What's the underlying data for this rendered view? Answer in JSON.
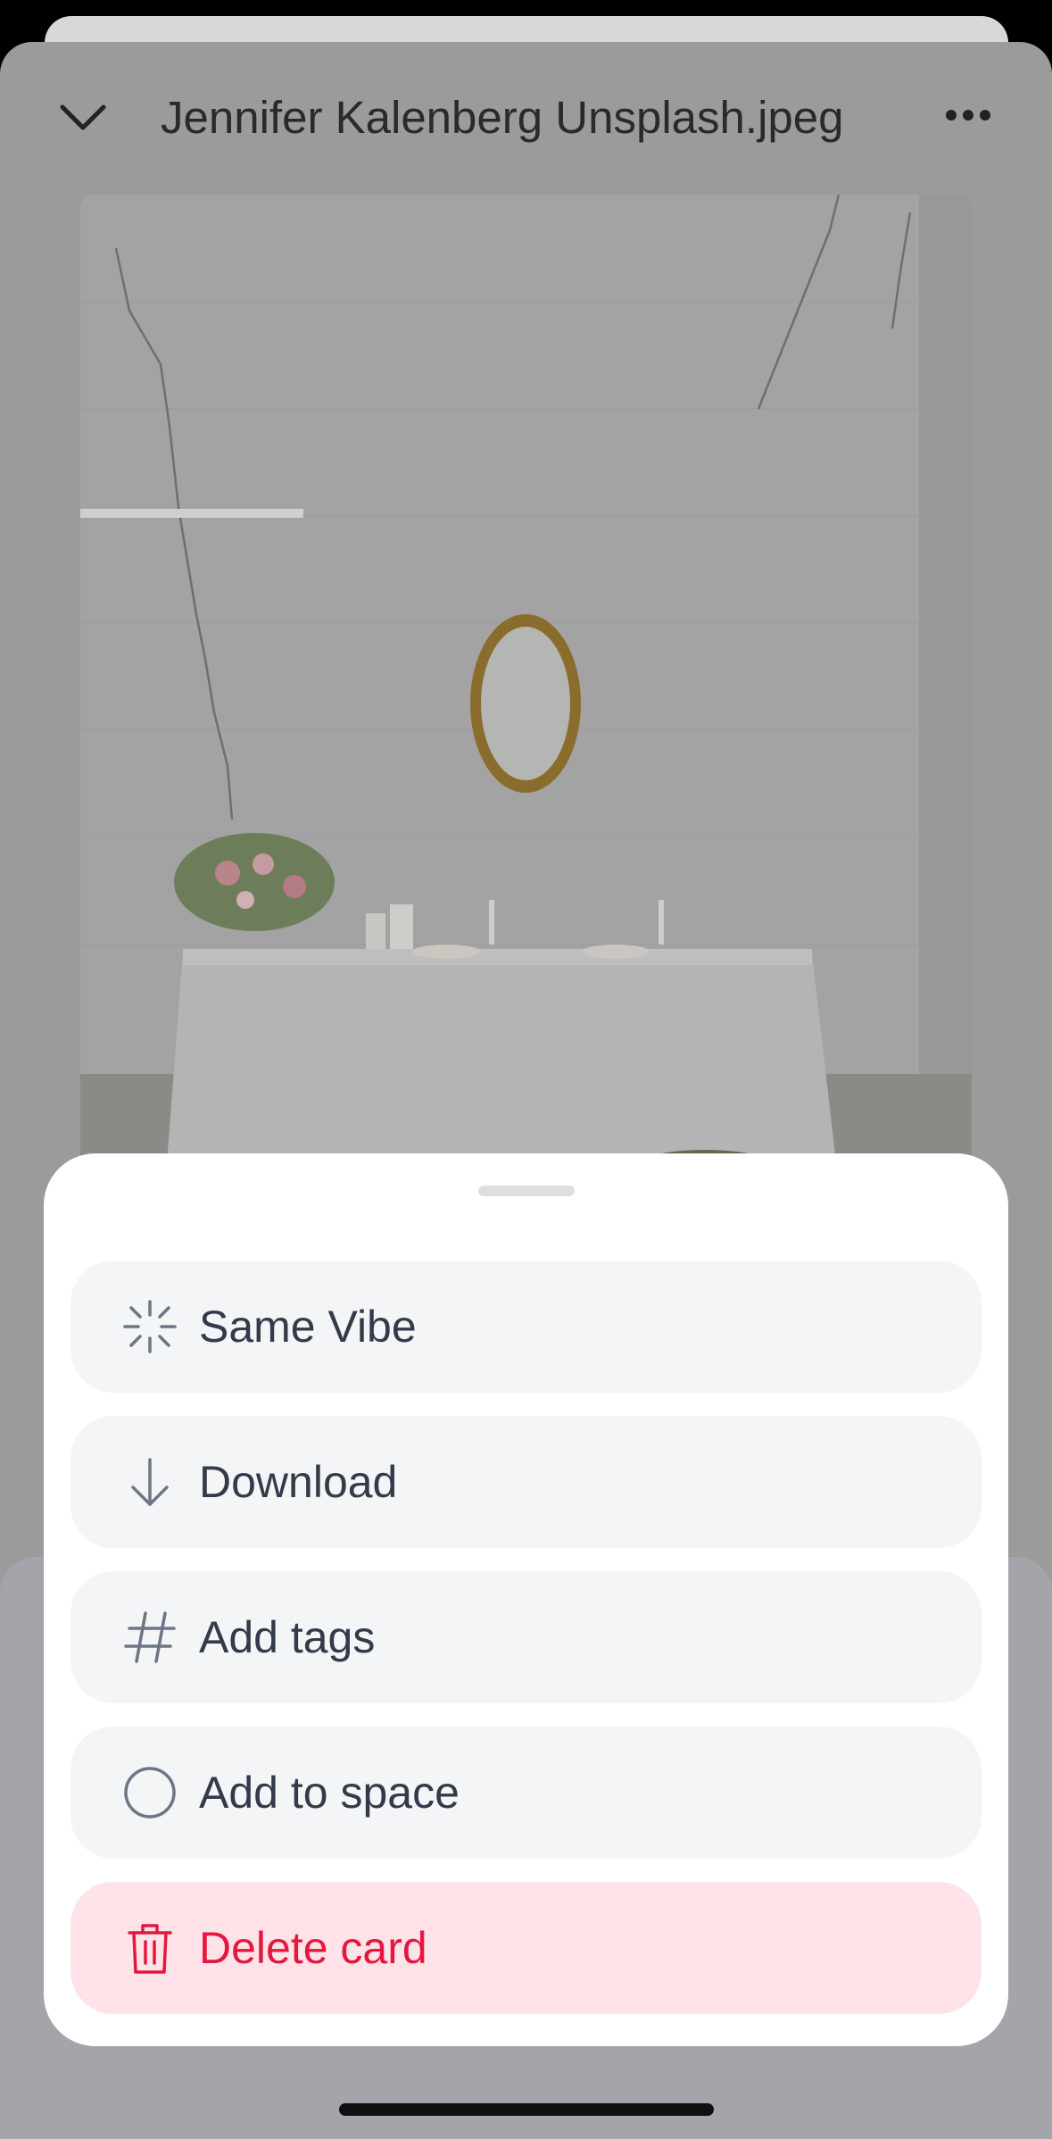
{
  "header": {
    "title": "Jennifer Kalenberg Unsplash.jpeg"
  },
  "photo": {
    "alt": "White brick room with gold mirror, table with white cloth, candles and flowers"
  },
  "sheet": {
    "actions": [
      {
        "label": "Same Vibe",
        "icon": "sparkle-icon"
      },
      {
        "label": "Download",
        "icon": "arrow-down-icon"
      },
      {
        "label": "Add tags",
        "icon": "hashtag-icon"
      },
      {
        "label": "Add to space",
        "icon": "circle-icon"
      },
      {
        "label": "Delete card",
        "icon": "trash-icon"
      }
    ]
  },
  "colors": {
    "danger": "#e5173f",
    "danger_bg": "#ffe3e8",
    "action_bg": "#f4f5f7",
    "text": "#333a4a"
  }
}
